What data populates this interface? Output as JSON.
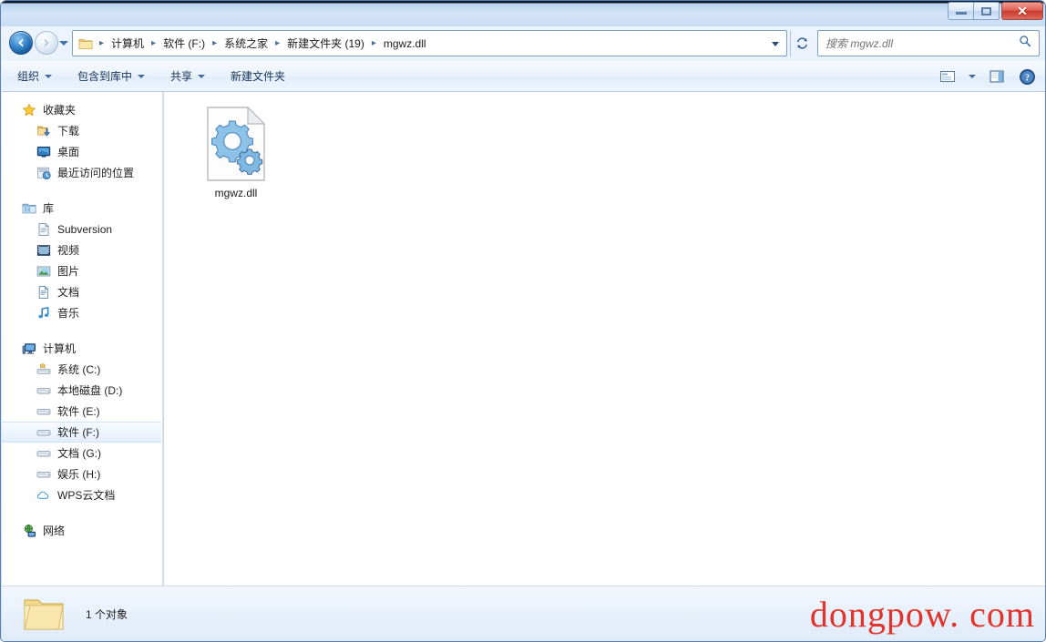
{
  "window": {
    "title": "",
    "buttons": {
      "minimize": "minimize",
      "maximize": "restore",
      "close": "close"
    }
  },
  "address_bar": {
    "back_tooltip": "后退",
    "forward_tooltip": "前进",
    "history_tooltip": "最近访问的位置",
    "refresh_tooltip": "刷新",
    "breadcrumbs": [
      "计算机",
      "软件 (F:)",
      "系统之家",
      "新建文件夹 (19)",
      "mgwz.dll"
    ],
    "separator": "▸"
  },
  "search": {
    "placeholder": "搜索 mgwz.dll",
    "value": "",
    "icon": "search-icon"
  },
  "toolbar": {
    "items": [
      {
        "label": "组织",
        "has_caret": true
      },
      {
        "label": "包含到库中",
        "has_caret": true
      },
      {
        "label": "共享",
        "has_caret": true
      },
      {
        "label": "新建文件夹",
        "has_caret": false
      }
    ],
    "right_icons": [
      "change-view-icon",
      "view-caret-icon",
      "preview-pane-icon",
      "help-icon"
    ]
  },
  "sidebar": {
    "groups": [
      {
        "header": {
          "label": "收藏夹",
          "icon": "star-icon"
        },
        "items": [
          {
            "label": "下载",
            "icon": "download-icon"
          },
          {
            "label": "桌面",
            "icon": "desktop-icon"
          },
          {
            "label": "最近访问的位置",
            "icon": "recent-places-icon"
          }
        ]
      },
      {
        "header": {
          "label": "库",
          "icon": "library-icon"
        },
        "items": [
          {
            "label": "Subversion",
            "icon": "subversion-icon"
          },
          {
            "label": "视频",
            "icon": "video-icon"
          },
          {
            "label": "图片",
            "icon": "pictures-icon"
          },
          {
            "label": "文档",
            "icon": "documents-icon"
          },
          {
            "label": "音乐",
            "icon": "music-icon"
          }
        ]
      },
      {
        "header": {
          "label": "计算机",
          "icon": "computer-icon"
        },
        "items": [
          {
            "label": "系统 (C:)",
            "icon": "system-drive-icon",
            "selected": false
          },
          {
            "label": "本地磁盘 (D:)",
            "icon": "drive-icon",
            "selected": false
          },
          {
            "label": "软件 (E:)",
            "icon": "drive-icon",
            "selected": false
          },
          {
            "label": "软件 (F:)",
            "icon": "drive-icon",
            "selected": true
          },
          {
            "label": "文档 (G:)",
            "icon": "drive-icon",
            "selected": false
          },
          {
            "label": "娱乐 (H:)",
            "icon": "drive-icon",
            "selected": false
          },
          {
            "label": "WPS云文档",
            "icon": "cloud-icon",
            "selected": false
          }
        ]
      },
      {
        "header": {
          "label": "网络",
          "icon": "network-icon"
        },
        "items": []
      }
    ]
  },
  "file_pane": {
    "items": [
      {
        "name": "mgwz.dll",
        "icon": "dll-file-icon",
        "selected": false
      }
    ]
  },
  "status_bar": {
    "icon": "folder-icon",
    "text": "1 个对象"
  },
  "watermark": {
    "text": "dongpow. com",
    "color": "#e2342c"
  },
  "colors": {
    "accent": "#1d5fa8",
    "selection": "#e3eefb",
    "frame": "#5a81b5",
    "close_button": "#c93a2c"
  }
}
